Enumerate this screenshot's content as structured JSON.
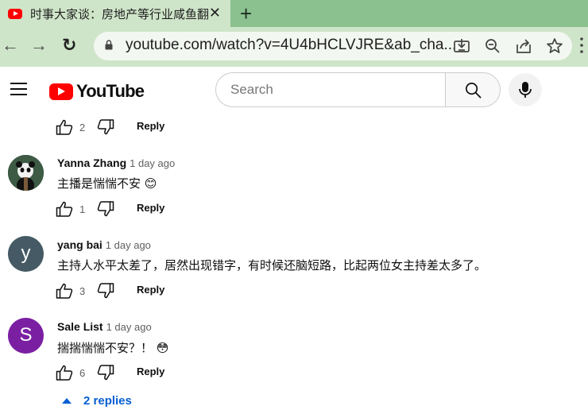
{
  "browser": {
    "tab_title": "时事大家谈：房地产等行业咸鱼翻",
    "tab_close": "✕",
    "new_tab": "+",
    "back": "←",
    "forward": "→",
    "reload": "↻",
    "url": "youtube.com/watch?v=4U4bHCLVJRE&ab_cha..."
  },
  "youtube": {
    "logo_text": "YouTube",
    "search_placeholder": "Search"
  },
  "comments": [
    {
      "likes": "2",
      "reply_label": "Reply"
    },
    {
      "author": "Yanna Zhang",
      "time": "1 day ago",
      "text": "主播是惴惴不安 😊",
      "likes": "1",
      "reply_label": "Reply",
      "avatar_letter": "",
      "avatar_color": "#2f4a3a"
    },
    {
      "author": "yang bai",
      "time": "1 day ago",
      "text": "主持人水平太差了，居然出现错字，有时候还脑短路，比起两位女主持差太多了。",
      "likes": "3",
      "reply_label": "Reply",
      "avatar_letter": "y",
      "avatar_color": "#455a64"
    },
    {
      "author": "Sale List",
      "time": "1 day ago",
      "text": "揣揣惴惴不安？！ 😳",
      "likes": "6",
      "reply_label": "Reply",
      "avatar_letter": "S",
      "avatar_color": "#7b1fa2"
    }
  ],
  "replies_toggle": "2 replies"
}
